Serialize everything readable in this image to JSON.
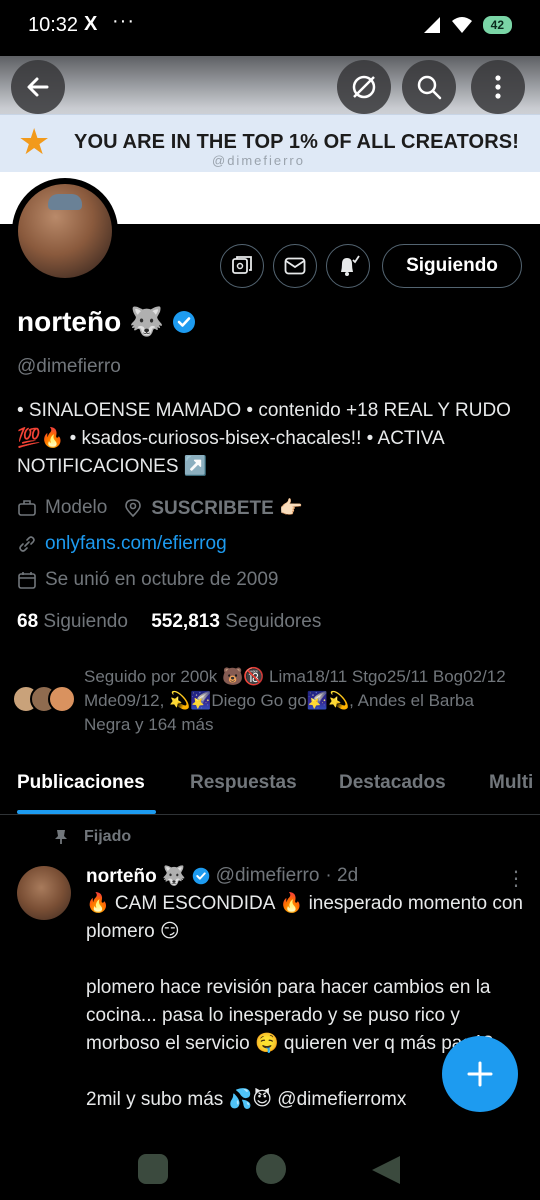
{
  "status_bar": {
    "time": "10:32",
    "app_icon": "X",
    "more": "···",
    "battery": "42"
  },
  "banner": {
    "top_text": "YOU ARE IN THE TOP 1% OF ALL CREATORS!",
    "watermark": "@dimefierro"
  },
  "profile": {
    "name": "norteño 🐺",
    "handle": "@dimefierro",
    "bio": "• SINALOENSE MAMADO • contenido +18 REAL Y RUDO 💯🔥 • ksados-curiosos-bisex-chacales!! • ACTIVA NOTIFICACIONES ↗️",
    "category": "Modelo",
    "location": "SUSCRIBETE 👉🏻",
    "link": "onlyfans.com/efierrog",
    "joined": "Se unió en octubre de 2009",
    "following_count": "68",
    "following_label": "Siguiendo",
    "followers_count": "552,813",
    "followers_label": "Seguidores",
    "followed_by": "Seguido por 200k 🐻🔞 Lima18/11 Stgo25/11 Bog02/12 Mde09/12, 💫🌠Diego Go go🌠💫, Andes el Barba Negra y 164 más",
    "follow_button": "Siguiendo"
  },
  "tabs": [
    "Publicaciones",
    "Respuestas",
    "Destacados",
    "Multi"
  ],
  "pinned_post": {
    "pinned_label": "Fijado",
    "author": "norteño 🐺",
    "handle": "@dimefierro",
    "time": "· 2d",
    "text": "🔥 CAM ESCONDIDA 🔥 inesperado momento con plomero 😏\n\nplomero hace revisión para hacer cambios en la cocina... pasa lo inesperado y se puso rico y morboso el servicio 🤤 quieren ver q más pasó?\n\n2mil y subo más 💦😈 @dimefierromx"
  },
  "colors": {
    "accent": "#1d9bf0",
    "muted": "#71767b",
    "background": "#000000",
    "star": "#f29a1b"
  },
  "icons": [
    "back-arrow-icon",
    "no-sync-icon",
    "search-icon",
    "more-vert-icon",
    "star-icon",
    "subscription-icon",
    "mail-icon",
    "bell-icon",
    "verified-icon",
    "briefcase-icon",
    "location-icon",
    "link-icon",
    "calendar-icon",
    "pin-icon",
    "plus-icon"
  ]
}
